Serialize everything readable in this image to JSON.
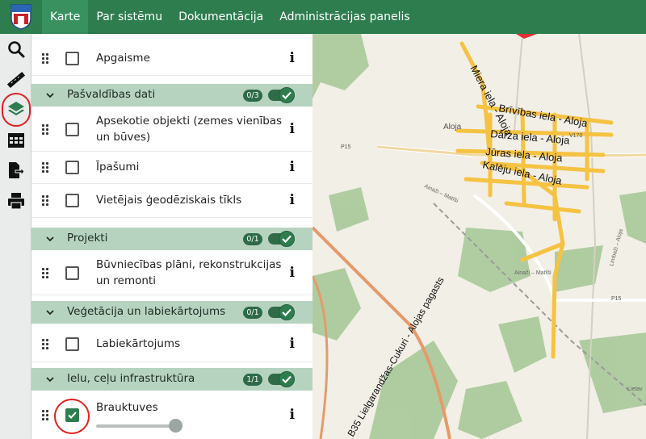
{
  "nav": {
    "tabs": [
      {
        "label": "Karte",
        "active": true
      },
      {
        "label": "Par sistēmu",
        "active": false
      },
      {
        "label": "Dokumentācija",
        "active": false
      },
      {
        "label": "Administrācijas panelis",
        "active": false
      }
    ]
  },
  "tools": [
    {
      "icon": "search-icon"
    },
    {
      "icon": "ruler-icon"
    },
    {
      "icon": "layers-icon",
      "active": true
    },
    {
      "icon": "table-icon"
    },
    {
      "icon": "export-icon"
    },
    {
      "icon": "print-icon"
    }
  ],
  "layers": {
    "apgaisme": {
      "label": "Apgaisme",
      "checked": false
    },
    "g1": {
      "label": "Pašvaldības dati",
      "count": "0/3",
      "enabled": true
    },
    "apsekotie": {
      "label1": "Apsekotie objekti (zemes vienības",
      "label2": "un būves)",
      "checked": false
    },
    "ipasumi": {
      "label": "Īpašumi",
      "checked": false
    },
    "geodez": {
      "label": "Vietējais ģeodēziskais tīkls",
      "checked": false
    },
    "g2": {
      "label": "Projekti",
      "count": "0/1",
      "enabled": true
    },
    "buvn": {
      "label1": "Būvniecības plāni, rekonstrukcijas",
      "label2": "un remonti",
      "checked": false
    },
    "g3": {
      "label": "Veģetācija un labiekārtojums",
      "count": "0/1",
      "enabled": true
    },
    "labiek": {
      "label": "Labiekārtojums",
      "checked": false
    },
    "g4": {
      "label": "Ielu, ceļu infrastruktūra",
      "count": "1/1",
      "enabled": true
    },
    "braukt": {
      "label": "Brauktuves",
      "checked": true,
      "opacity": 0.9
    },
    "info_glyph": "i"
  },
  "map": {
    "town_label": "Aloja",
    "roads": {
      "p15_a": "P15",
      "p15_b": "P15",
      "v170": "V170"
    },
    "street_labels": [
      "Miera iela - Aloja",
      "Brīvības iela - Aloja",
      "Dārza iela - Aloja",
      "Jūras iela - Aloja",
      "Kalēju iela - Aloja"
    ],
    "highway_label": "B35 Lielgarandžas-Cukuri - Alojas pagasts",
    "small_labels": [
      "Ainaži – Matīši",
      "Ainaži – Matīši",
      "Limbaži – Aloja",
      "Lietav"
    ],
    "colors": {
      "road": "#f5c242",
      "road_edge": "#d9a22e",
      "forest": "#a8c99a",
      "base": "#f2efe6"
    }
  }
}
